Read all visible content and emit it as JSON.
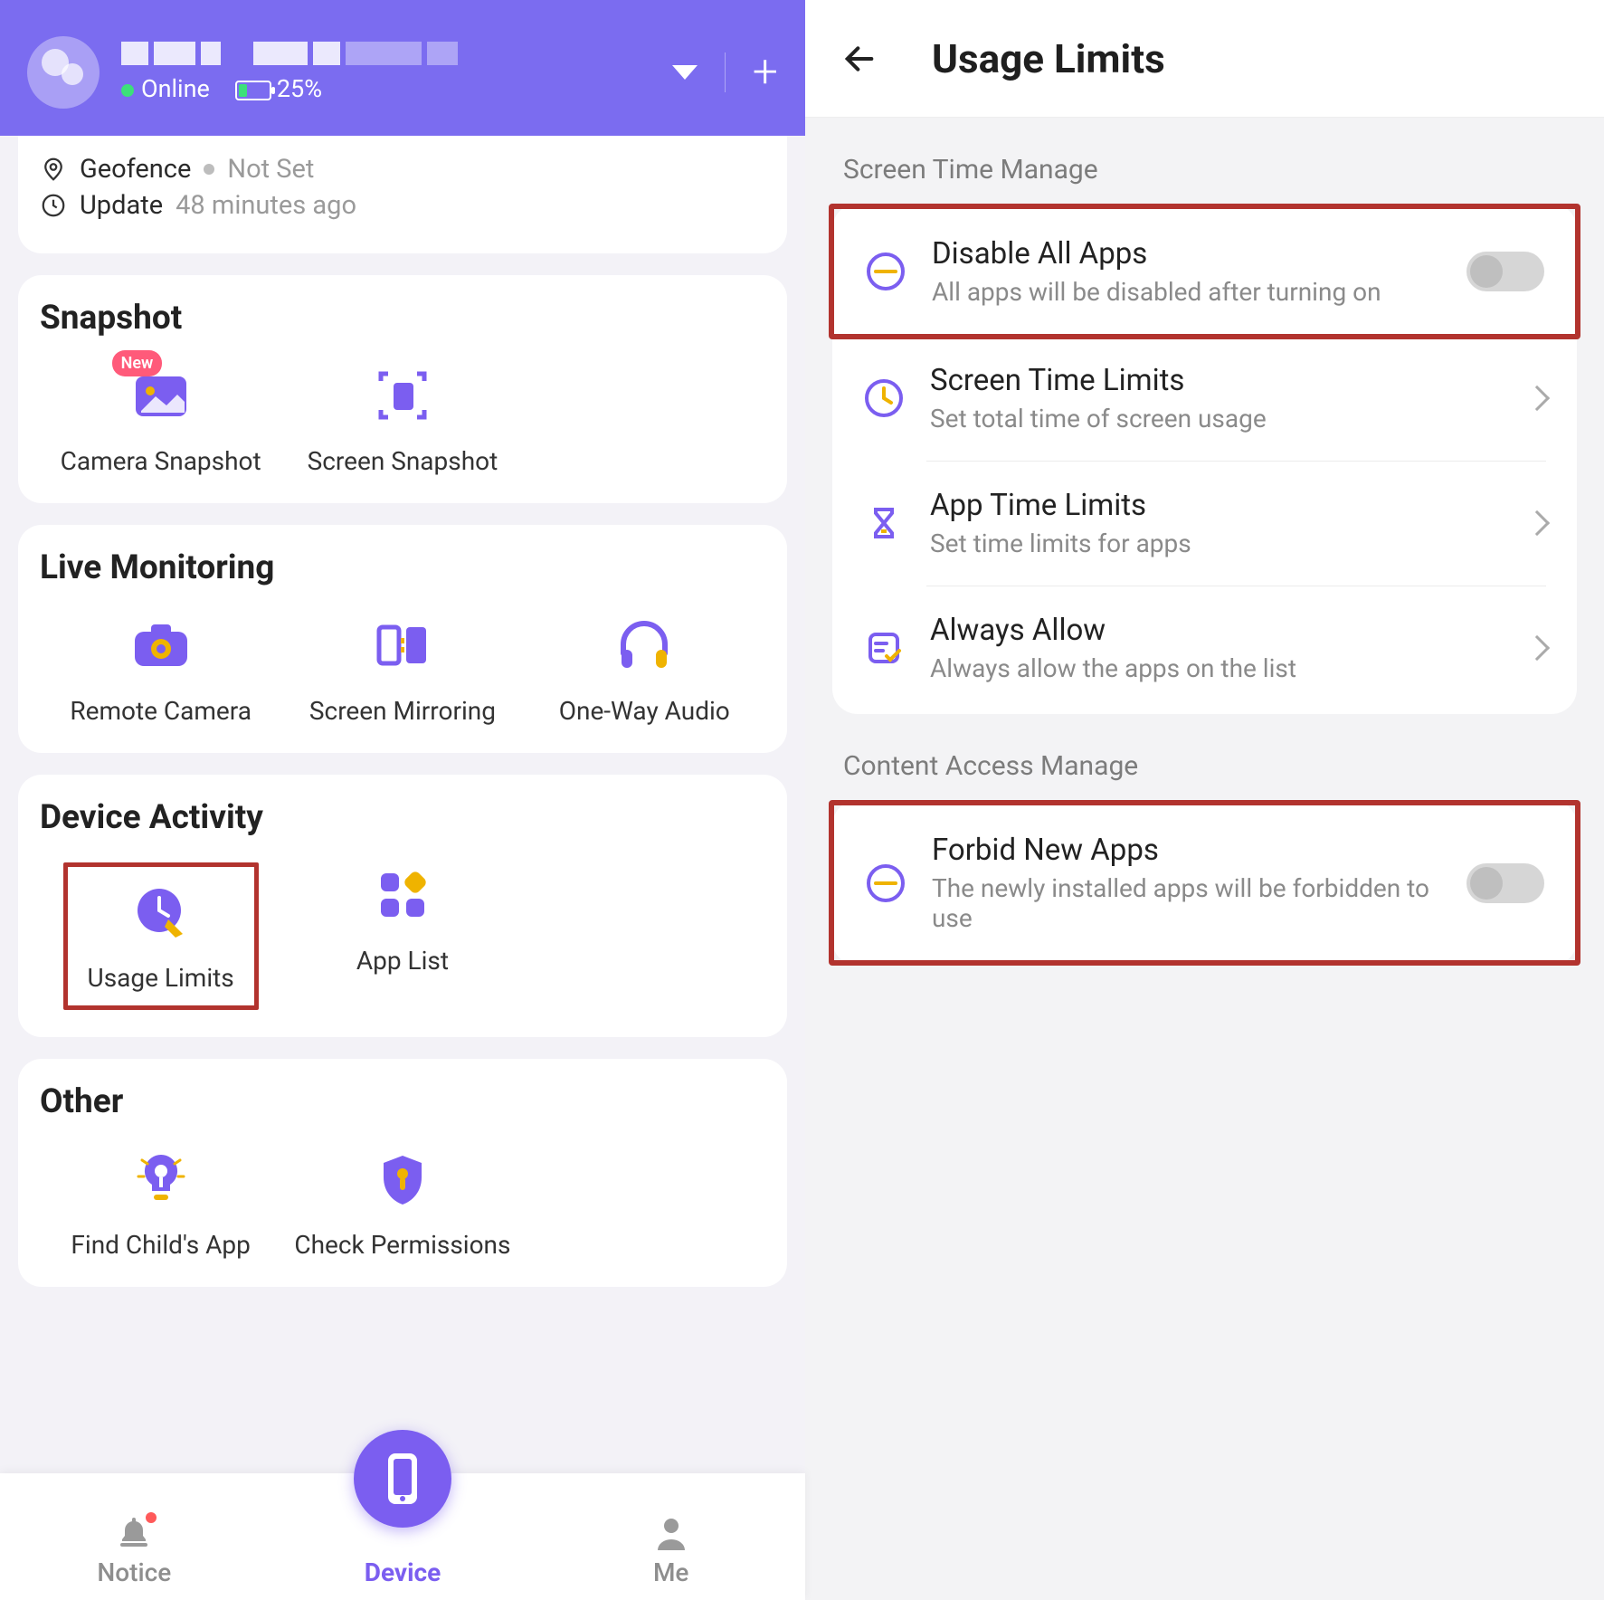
{
  "header": {
    "status_online": "Online",
    "battery_pct": "25%"
  },
  "info_card": {
    "geofence_label": "Geofence",
    "geofence_value": "Not Set",
    "update_label": "Update",
    "update_value": "48 minutes ago"
  },
  "sections": {
    "snapshot": {
      "title": "Snapshot",
      "tiles": [
        {
          "label": "Camera Snapshot",
          "badge": "New"
        },
        {
          "label": "Screen Snapshot"
        }
      ]
    },
    "live": {
      "title": "Live Monitoring",
      "tiles": [
        {
          "label": "Remote Camera"
        },
        {
          "label": "Screen Mirroring"
        },
        {
          "label": "One-Way Audio"
        }
      ]
    },
    "activity": {
      "title": "Device Activity",
      "tiles": [
        {
          "label": "Usage Limits"
        },
        {
          "label": "App List"
        }
      ]
    },
    "other": {
      "title": "Other",
      "tiles": [
        {
          "label": "Find Child's App"
        },
        {
          "label": "Check Permissions"
        }
      ]
    }
  },
  "bottom_nav": {
    "notice": "Notice",
    "device": "Device",
    "me": "Me"
  },
  "right": {
    "title": "Usage Limits",
    "section1": "Screen Time Manage",
    "section2": "Content Access Manage",
    "rows": {
      "disable_all": {
        "title": "Disable All Apps",
        "sub": "All apps will be disabled after turning on"
      },
      "screen_time": {
        "title": "Screen Time Limits",
        "sub": "Set total time of screen usage"
      },
      "app_time": {
        "title": "App Time Limits",
        "sub": "Set time limits for apps"
      },
      "always_allow": {
        "title": "Always Allow",
        "sub": "Always allow the apps on the list"
      },
      "forbid_new": {
        "title": "Forbid New Apps",
        "sub": "The newly installed apps will be forbidden to use"
      }
    }
  },
  "colors": {
    "accent": "#7b5ef0",
    "accent_alt": "#efb300",
    "highlight": "#b2332e"
  }
}
